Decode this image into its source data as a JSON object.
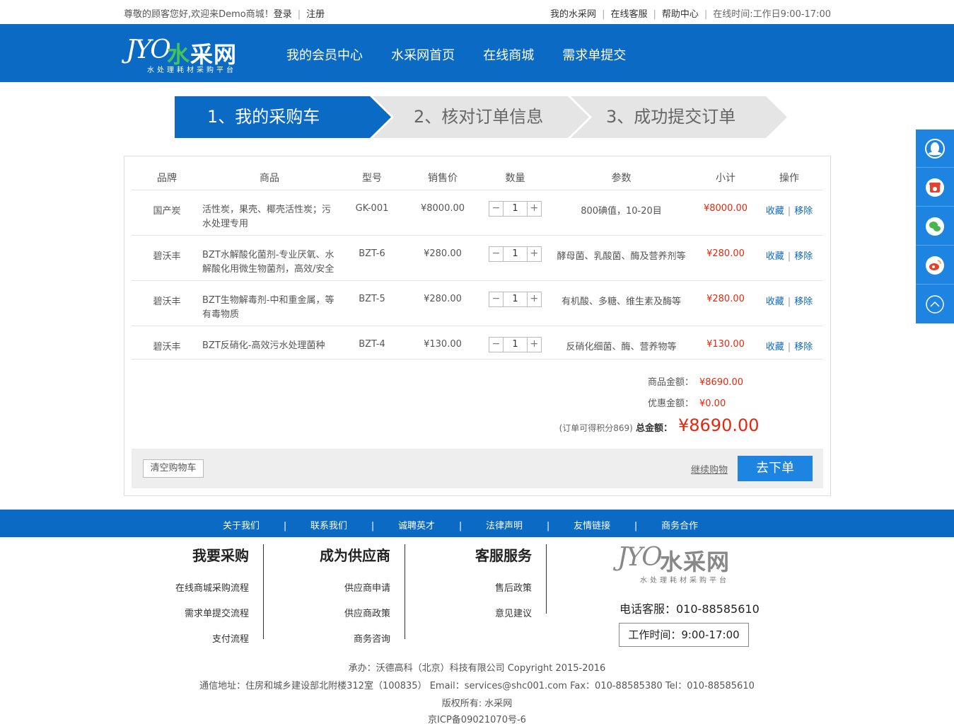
{
  "topbar": {
    "greeting": "尊敬的顾客您好,欢迎来Demo商城！",
    "login": "登录",
    "register": "注册",
    "links": [
      "我的水采网",
      "在线客服",
      "帮助中心"
    ],
    "hours": "在线时间:工作日9:00-17:00"
  },
  "header": {
    "logo_mark": "JYO",
    "logo_first": "水",
    "logo_rest": "采网",
    "logo_sub": "水处理耗材采购平台",
    "nav": [
      "我的会员中心",
      "水采网首页",
      "在线商城",
      "需求单提交"
    ]
  },
  "steps": [
    "1、我的采购车",
    "2、核对订单信息",
    "3、成功提交订单"
  ],
  "table": {
    "headers": [
      "品牌",
      "商品",
      "型号",
      "销售价",
      "数量",
      "参数",
      "小计",
      "操作"
    ],
    "rows": [
      {
        "brand": "国产炭",
        "goods": "活性炭，果壳、椰壳活性炭；污水处理专用",
        "model": "GK-001",
        "price": "¥8000.00",
        "qty": "1",
        "param": "800碘值，10-20目",
        "subtotal": "¥8000.00"
      },
      {
        "brand": "碧沃丰",
        "goods": "BZT水解酸化菌剂-专业厌氧、水解酸化用微生物菌剂，高效/安全",
        "model": "BZT-6",
        "price": "¥280.00",
        "qty": "1",
        "param": "酵母菌、乳酸菌、酶及营养剂等",
        "subtotal": "¥280.00"
      },
      {
        "brand": "碧沃丰",
        "goods": "BZT生物解毒剂-中和重金属，等有毒物质",
        "model": "BZT-5",
        "price": "¥280.00",
        "qty": "1",
        "param": "有机酸、多糖、维生素及酶等",
        "subtotal": "¥280.00"
      },
      {
        "brand": "碧沃丰",
        "goods": "BZT反硝化-高效污水处理菌种",
        "model": "BZT-4",
        "price": "¥130.00",
        "qty": "1",
        "param": "反硝化细菌、酶、营养物等",
        "subtotal": "¥130.00"
      }
    ],
    "op_fav": "收藏",
    "op_remove": "移除",
    "minus": "−",
    "plus": "+"
  },
  "totals": {
    "goods_label": "商品金额：",
    "goods_amount": "¥8690.00",
    "discount_label": "优惠金额：",
    "discount_amount": "¥0.00",
    "points_hint": "(订单可得积分869)",
    "total_label": "总金额：",
    "total_amount": "¥8690.00"
  },
  "cart_actions": {
    "clear": "清空购物车",
    "continue": "继续购物",
    "order": "去下单"
  },
  "sidefloat": [
    "qq-icon",
    "phone-icon",
    "wechat-icon",
    "weibo-icon",
    "back-to-top-icon"
  ],
  "footer": {
    "nav": [
      "关于我们",
      "联系我们",
      "诚聘英才",
      "法律声明",
      "友情链接",
      "商务合作"
    ],
    "nav_sep": "|",
    "col1": {
      "title": "我要采购",
      "links": [
        "在线商城采购流程",
        "需求单提交流程",
        "支付流程"
      ]
    },
    "col2": {
      "title": "成为供应商",
      "links": [
        "供应商申请",
        "供应商政策",
        "商务咨询"
      ]
    },
    "col3": {
      "title": "客服服务",
      "links": [
        "售后政策",
        "意见建议"
      ]
    },
    "phone": "电话客服：010-88585610",
    "hours": "工作时间：9:00-17:00",
    "copy1": "承办：沃德高科（北京）科技有限公司 Copyright 2015-2016",
    "copy2": "通信地址：住房和城乡建设部北附楼312室（100835） Email：services@shc001.com  Fax：010-88585380 Tel：010-88585610",
    "copy3": "版权所有: 水采网",
    "copy4": "京ICP备09021070号-6"
  },
  "colors": {
    "primary": "#0a6ac4",
    "button": "#1e84e2",
    "price_red": "#e4280e",
    "step_inactive": "#e5e5e5"
  }
}
